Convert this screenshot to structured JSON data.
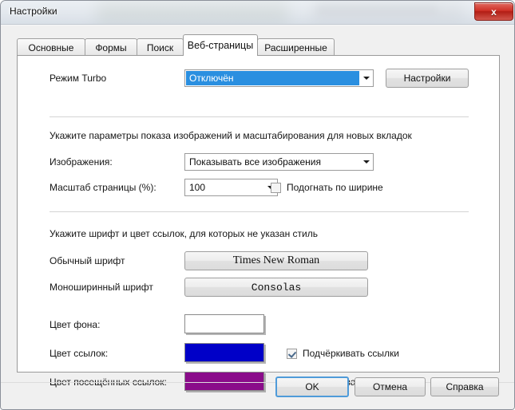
{
  "window": {
    "title": "Настройки",
    "close_label": "x"
  },
  "tabs": [
    {
      "label": "Основные",
      "active": false
    },
    {
      "label": "Формы",
      "active": false
    },
    {
      "label": "Поиск",
      "active": false
    },
    {
      "label": "Веб-страницы",
      "active": true
    },
    {
      "label": "Расширенные",
      "active": false
    }
  ],
  "turbo": {
    "label": "Режим Turbo",
    "value": "Отключён",
    "settings_button": "Настройки"
  },
  "images_section": {
    "note": "Укажите параметры показа изображений и масштабирования для новых вкладок",
    "images_label": "Изображения:",
    "images_value": "Показывать все изображения",
    "zoom_label": "Масштаб страницы (%):",
    "zoom_value": "100",
    "fit_width_label": "Подогнать по ширине",
    "fit_width_checked": false
  },
  "fonts_section": {
    "note": "Укажите шрифт и цвет ссылок, для которых не указан стиль",
    "normal_font_label": "Обычный шрифт",
    "normal_font_value": "Times New Roman",
    "mono_font_label": "Моноширинный шрифт",
    "mono_font_value": "Consolas"
  },
  "colors_section": {
    "background_label": "Цвет фона:",
    "background_color": "#ffffff",
    "link_label": "Цвет ссылок:",
    "link_color": "#0000c8",
    "visited_label": "Цвет посещённых ссылок:",
    "visited_color": "#8a0c8a",
    "underline_links_label": "Подчёркивать ссылки",
    "underline_links_checked": true,
    "underline_visited_label": "Подчёркивать посещённые",
    "underline_visited_checked": true
  },
  "footer": {
    "ok": "OK",
    "cancel": "Отмена",
    "help": "Справка"
  }
}
